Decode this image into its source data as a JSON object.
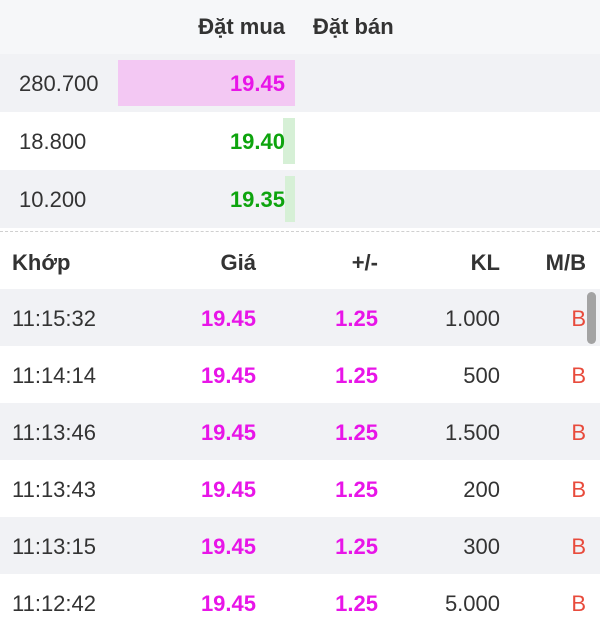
{
  "colors": {
    "ceiling": "#e815e8",
    "up": "#0ea40e",
    "ceiling_bar": "#f3c8f3",
    "up_bar": "#d6f0d6",
    "buy_side": "#e84b3c"
  },
  "order_book": {
    "header": {
      "buy": "Đặt mua",
      "sell": "Đặt bán"
    },
    "rows": [
      {
        "volume": "280.700",
        "price": "19.45",
        "color": "#e815e8",
        "bar_color": "#f3c8f3",
        "depth": 1.0
      },
      {
        "volume": "18.800",
        "price": "19.40",
        "color": "#0ea40e",
        "bar_color": "#d6f0d6",
        "depth": 0.067
      },
      {
        "volume": "10.200",
        "price": "19.35",
        "color": "#0ea40e",
        "bar_color": "#d6f0d6",
        "depth": 0.036
      }
    ]
  },
  "trades": {
    "header": {
      "time": "Khớp",
      "price": "Giá",
      "change": "+/-",
      "volume": "KL",
      "side": "M/B"
    },
    "rows": [
      {
        "time": "11:15:32",
        "price": "19.45",
        "change": "1.25",
        "volume": "1.000",
        "side": "B"
      },
      {
        "time": "11:14:14",
        "price": "19.45",
        "change": "1.25",
        "volume": "500",
        "side": "B"
      },
      {
        "time": "11:13:46",
        "price": "19.45",
        "change": "1.25",
        "volume": "1.500",
        "side": "B"
      },
      {
        "time": "11:13:43",
        "price": "19.45",
        "change": "1.25",
        "volume": "200",
        "side": "B"
      },
      {
        "time": "11:13:15",
        "price": "19.45",
        "change": "1.25",
        "volume": "300",
        "side": "B"
      },
      {
        "time": "11:12:42",
        "price": "19.45",
        "change": "1.25",
        "volume": "5.000",
        "side": "B"
      }
    ]
  }
}
